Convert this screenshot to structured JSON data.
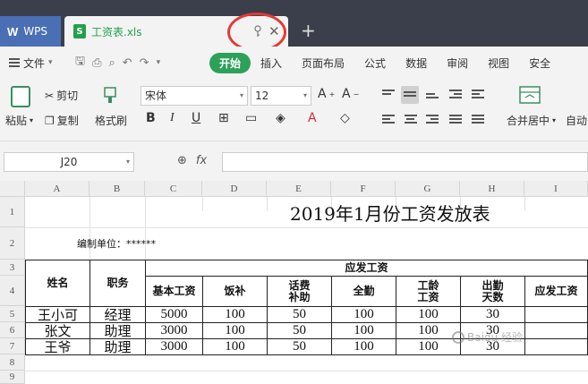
{
  "titlebar": {
    "wps_label": "WPS",
    "file_name": "工资表.xls",
    "add_tab": "+"
  },
  "menubar": {
    "file_label": "文件",
    "items": [
      "开始",
      "插入",
      "页面布局",
      "公式",
      "数据",
      "审阅",
      "视图",
      "安全"
    ],
    "active": "开始"
  },
  "ribbon": {
    "paste": "粘贴",
    "cut": "剪切",
    "copy": "复制",
    "format_painter": "格式刷",
    "font_name": "宋体",
    "font_size": "12",
    "merge_center": "合并居中",
    "auto_wrap": "自动"
  },
  "formulabar": {
    "cell_ref": "J20",
    "fx_label": "fx",
    "formula": ""
  },
  "sheet": {
    "columns": [
      "A",
      "B",
      "C",
      "D",
      "E",
      "F",
      "G",
      "H",
      "I"
    ],
    "rows": [
      "1",
      "2",
      "3",
      "4",
      "5",
      "6",
      "7",
      "8",
      "9"
    ],
    "title": "2019年1月份工资发放表",
    "unit_label": "编制单位：******",
    "header_name": "姓名",
    "header_role": "职务",
    "header_group": "应发工资",
    "header_cols": [
      "基本工资",
      "饭补",
      "话费\n补助",
      "全勤",
      "工龄\n工资",
      "出勤\n天数",
      "应发工资"
    ],
    "data_rows": [
      {
        "name": "王小可",
        "role": "经理",
        "base": "5000",
        "meal": "100",
        "phone": "50",
        "attend": "100",
        "seniority": "100",
        "days": "30"
      },
      {
        "name": "张文",
        "role": "助理",
        "base": "3000",
        "meal": "100",
        "phone": "50",
        "attend": "100",
        "seniority": "100",
        "days": "30"
      },
      {
        "name": "王爷",
        "role": "助理",
        "base": "3000",
        "meal": "100",
        "phone": "50",
        "attend": "100",
        "seniority": "100",
        "days": "30"
      }
    ]
  },
  "watermark": "Baidu 经验"
}
